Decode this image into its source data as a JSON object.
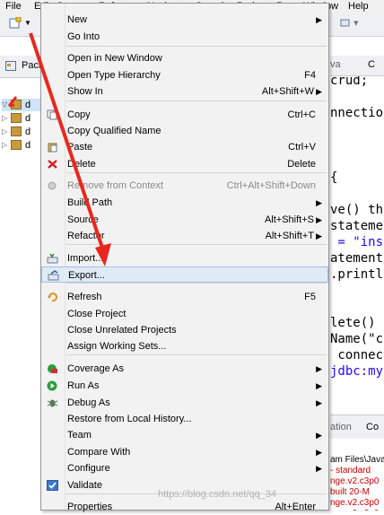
{
  "menubar": {
    "items": [
      {
        "label": "File"
      },
      {
        "label": "Edit"
      },
      {
        "label": "Source"
      },
      {
        "label": "Refactor"
      },
      {
        "label": "Navigate"
      },
      {
        "label": "Search"
      },
      {
        "label": "Project"
      },
      {
        "label": "Run"
      },
      {
        "label": "Window"
      },
      {
        "label": "Help"
      }
    ]
  },
  "package_explorer": {
    "tab_label": "Pack",
    "tree": [
      {
        "label": "d"
      },
      {
        "label": "d"
      },
      {
        "label": "d"
      },
      {
        "label": "d"
      }
    ]
  },
  "editor": {
    "tabs": [
      "va",
      "C"
    ],
    "lines": [
      {
        "text": "crud;",
        "color": "#000000"
      },
      {
        "text": "",
        "color": "#000000"
      },
      {
        "text": "nnectio",
        "color": "#000000"
      },
      {
        "text": "",
        "color": "#000000"
      },
      {
        "text": "",
        "color": "#000000"
      },
      {
        "text": "",
        "color": "#000000"
      },
      {
        "text": "{",
        "color": "#000000"
      },
      {
        "text": "",
        "color": "#000000"
      },
      {
        "text": "ve() th",
        "color": "#000000"
      },
      {
        "text": "stateme",
        "color": "#000000"
      },
      {
        "text": " = \"ins",
        "color": "#2a00ff"
      },
      {
        "text": "atement",
        "color": "#000000"
      },
      {
        "text": ".printl",
        "color": "#000000"
      },
      {
        "text": "",
        "color": "#000000"
      },
      {
        "text": "",
        "color": "#000000"
      },
      {
        "text": "lete()",
        "color": "#000000"
      },
      {
        "text": "Name(\"co",
        "color": "#000000"
      },
      {
        "text": " connec",
        "color": "#000000"
      },
      {
        "text": "jdbc:my",
        "color": "#2a00ff"
      }
    ]
  },
  "console": {
    "tabs": [
      "ation",
      "Co"
    ],
    "lines": [
      {
        "text": "am Files\\Java",
        "color": "#000000"
      },
      {
        "text": "- standard",
        "color": "#c00000"
      },
      {
        "text": "nge.v2.c3p0",
        "color": "#c00000"
      },
      {
        "text": "built 20-M",
        "color": "#c00000"
      },
      {
        "text": "nge.v2.c3p0",
        "color": "#c00000"
      },
      {
        "text": "nge.v2.c3p0",
        "color": "#c00000"
      }
    ]
  },
  "context_menu": {
    "items": [
      {
        "label": "New",
        "shortcut": "",
        "submenu": true,
        "icon": "",
        "disabled": false
      },
      {
        "label": "Go Into",
        "shortcut": "",
        "submenu": false,
        "icon": "",
        "disabled": false
      },
      {
        "sep": true
      },
      {
        "label": "Open in New Window",
        "shortcut": "",
        "submenu": false,
        "icon": "",
        "disabled": false
      },
      {
        "label": "Open Type Hierarchy",
        "shortcut": "F4",
        "submenu": false,
        "icon": "",
        "disabled": false
      },
      {
        "label": "Show In",
        "shortcut": "Alt+Shift+W",
        "submenu": true,
        "icon": "",
        "disabled": false
      },
      {
        "sep": true
      },
      {
        "label": "Copy",
        "shortcut": "Ctrl+C",
        "submenu": false,
        "icon": "copy-icon",
        "disabled": false
      },
      {
        "label": "Copy Qualified Name",
        "shortcut": "",
        "submenu": false,
        "icon": "",
        "disabled": false
      },
      {
        "label": "Paste",
        "shortcut": "Ctrl+V",
        "submenu": false,
        "icon": "paste-icon",
        "disabled": false
      },
      {
        "label": "Delete",
        "shortcut": "Delete",
        "submenu": false,
        "icon": "delete-icon",
        "disabled": false
      },
      {
        "sep": true
      },
      {
        "label": "Remove from Context",
        "shortcut": "Ctrl+Alt+Shift+Down",
        "submenu": false,
        "icon": "remove-context-icon",
        "disabled": true
      },
      {
        "label": "Build Path",
        "shortcut": "",
        "submenu": true,
        "icon": "",
        "disabled": false
      },
      {
        "label": "Source",
        "shortcut": "Alt+Shift+S",
        "submenu": true,
        "icon": "",
        "disabled": false
      },
      {
        "label": "Refactor",
        "shortcut": "Alt+Shift+T",
        "submenu": true,
        "icon": "",
        "disabled": false
      },
      {
        "sep": true
      },
      {
        "label": "Import...",
        "shortcut": "",
        "submenu": false,
        "icon": "import-icon",
        "disabled": false
      },
      {
        "label": "Export...",
        "shortcut": "",
        "submenu": false,
        "icon": "export-icon",
        "disabled": false,
        "hover": true
      },
      {
        "sep": true
      },
      {
        "label": "Refresh",
        "shortcut": "F5",
        "submenu": false,
        "icon": "refresh-icon",
        "disabled": false
      },
      {
        "label": "Close Project",
        "shortcut": "",
        "submenu": false,
        "icon": "",
        "disabled": false
      },
      {
        "label": "Close Unrelated Projects",
        "shortcut": "",
        "submenu": false,
        "icon": "",
        "disabled": false
      },
      {
        "label": "Assign Working Sets...",
        "shortcut": "",
        "submenu": false,
        "icon": "",
        "disabled": false
      },
      {
        "sep": true
      },
      {
        "label": "Coverage As",
        "shortcut": "",
        "submenu": true,
        "icon": "coverage-icon",
        "disabled": false
      },
      {
        "label": "Run As",
        "shortcut": "",
        "submenu": true,
        "icon": "run-icon",
        "disabled": false
      },
      {
        "label": "Debug As",
        "shortcut": "",
        "submenu": true,
        "icon": "debug-icon",
        "disabled": false
      },
      {
        "label": "Restore from Local History...",
        "shortcut": "",
        "submenu": false,
        "icon": "",
        "disabled": false
      },
      {
        "label": "Team",
        "shortcut": "",
        "submenu": true,
        "icon": "",
        "disabled": false
      },
      {
        "label": "Compare With",
        "shortcut": "",
        "submenu": true,
        "icon": "",
        "disabled": false
      },
      {
        "label": "Configure",
        "shortcut": "",
        "submenu": true,
        "icon": "",
        "disabled": false
      },
      {
        "label": "Validate",
        "shortcut": "",
        "submenu": false,
        "icon": "validate-icon",
        "disabled": false
      },
      {
        "sep": true
      },
      {
        "label": "Properties",
        "shortcut": "Alt+Enter",
        "submenu": false,
        "icon": "",
        "disabled": false
      }
    ]
  },
  "colors": {
    "menu_bg": "#f2f2f2",
    "hover_bg": "#dfeaf7",
    "annotation_red": "#e8281e"
  },
  "watermark": "https://blog.csdn.net/qq_34"
}
